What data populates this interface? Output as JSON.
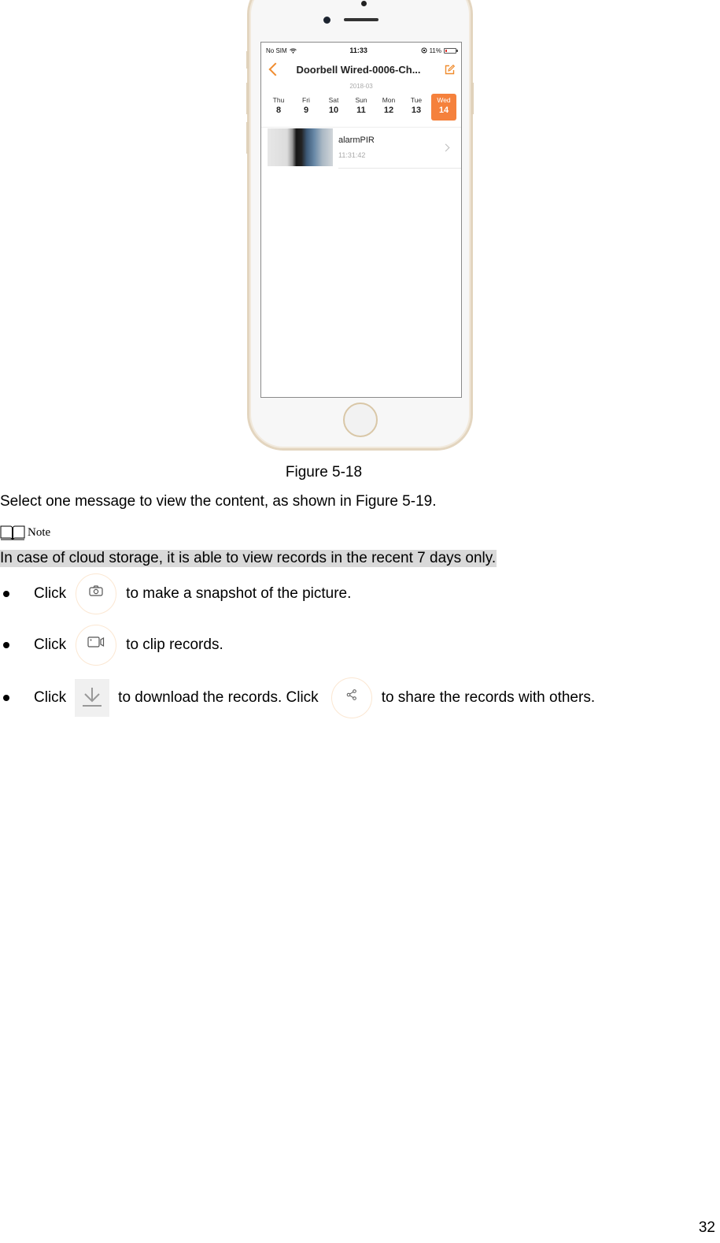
{
  "figure": {
    "phone": {
      "status_bar": {
        "carrier": "No SIM",
        "time": "11:33",
        "battery": "11%"
      },
      "nav": {
        "title": "Doorbell Wired-0006-Ch...",
        "back_icon": "chevron-left-icon",
        "edit_icon": "edit-icon"
      },
      "calendar": {
        "month": "2018-03",
        "days": [
          {
            "name": "Thu",
            "num": "8",
            "active": false
          },
          {
            "name": "Fri",
            "num": "9",
            "active": false
          },
          {
            "name": "Sat",
            "num": "10",
            "active": false
          },
          {
            "name": "Sun",
            "num": "11",
            "active": false
          },
          {
            "name": "Mon",
            "num": "12",
            "active": false
          },
          {
            "name": "Tue",
            "num": "13",
            "active": false
          },
          {
            "name": "Wed",
            "num": "14",
            "active": true
          }
        ]
      },
      "records": [
        {
          "title": "alarmPIR",
          "time": "11:31:42"
        }
      ],
      "accent_color": "#f5813c"
    },
    "caption": "Figure 5-18"
  },
  "body": {
    "intro": "Select one message to view the content, as shown in Figure 5-19.",
    "note_label": "Note",
    "note_text": "In case of cloud storage, it is able to view records in the recent 7 days only.",
    "bullets": [
      {
        "prefix": "Click",
        "icon": "camera-icon",
        "suffix": "to make a snapshot of the picture."
      },
      {
        "prefix": "Click",
        "icon": "video-clip-icon",
        "suffix": "to clip records."
      },
      {
        "prefix": "Click",
        "icon": "download-icon",
        "middle": "to download the records. Click",
        "icon2": "share-icon",
        "suffix": "to share the records with others."
      }
    ]
  },
  "page_number": "32"
}
